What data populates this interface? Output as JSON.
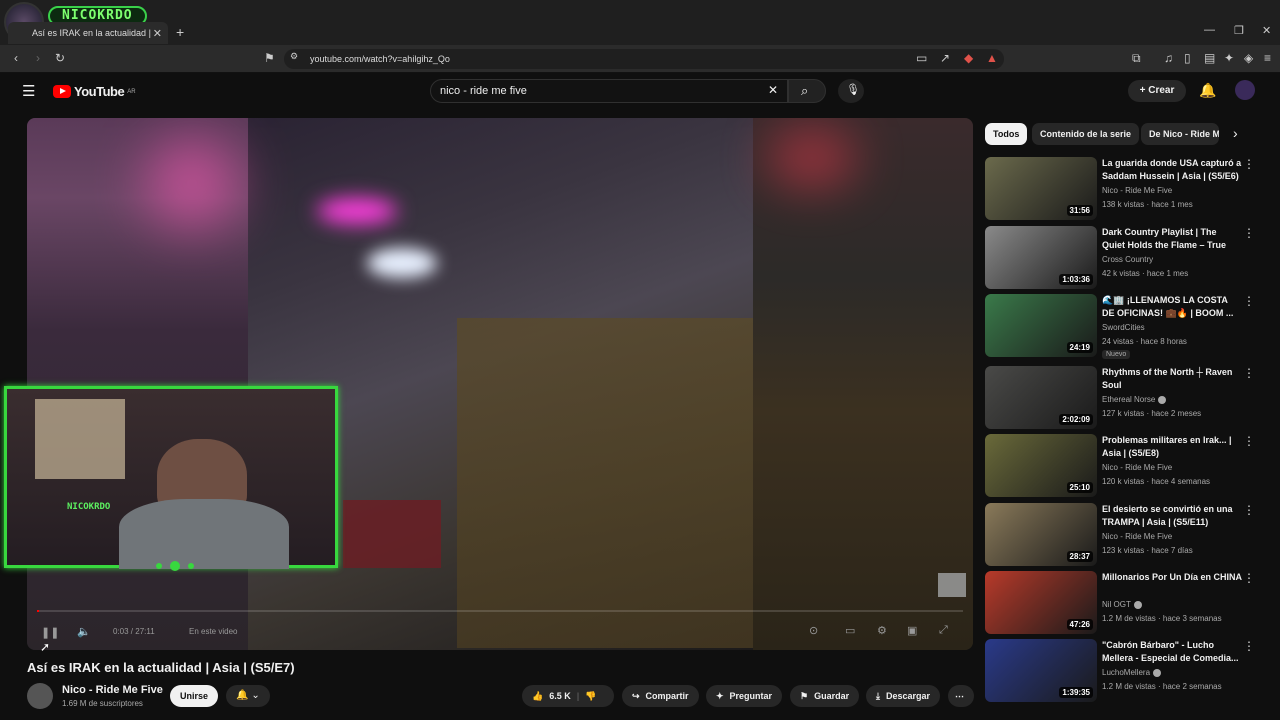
{
  "browser": {
    "tab_title": "Así es IRAK en la actualidad |",
    "url": "youtube.com/watch?v=ahilgihz_Qo",
    "overlay_name": "NICOKRDO"
  },
  "youtube": {
    "logo_text": "YouTube",
    "logo_region": "AR",
    "search_value": "nico - ride me five",
    "create_label": "Crear"
  },
  "player": {
    "time": "0:03 / 27:11",
    "watching": "En este video",
    "webcam_name": "NICOKRDO",
    "progress": 0.002
  },
  "video": {
    "title": "Así es IRAK en la actualidad | Asia | (S5/E7)",
    "channel": "Nico - Ride Me Five",
    "subscribers": "1.69 M de suscriptores",
    "join_label": "Unirse",
    "likes": "6.5 K",
    "share": "Compartir",
    "ask": "Preguntar",
    "save": "Guardar",
    "download": "Descargar"
  },
  "chips": [
    "Todos",
    "Contenido de la serie",
    "De Nico - Ride M"
  ],
  "recommendations": [
    {
      "title": "La guarida donde USA capturó a Saddam Hussein | Asia | (S5/E6)",
      "channel": "Nico - Ride Me Five",
      "meta": "138 k vistas · hace 1 mes",
      "duration": "31:56",
      "color": "#6b6a4c"
    },
    {
      "title": "Dark Country Playlist | The Quiet Holds the Flame – True Grit in ...",
      "channel": "Cross Country",
      "meta": "42 k vistas · hace 1 mes",
      "duration": "1:03:36",
      "color": "#8a8a8a"
    },
    {
      "title": "🌊🏢 ¡LLENAMOS LA COSTA DE OFICINAS! 💼🔥 | BOOM ...",
      "channel": "SwordCities",
      "meta": "24 vistas · hace 8 horas",
      "duration": "24:19",
      "color": "#3a7a4a",
      "badge": "Nuevo"
    },
    {
      "title": "Rhythms of the North ┼ Raven Soul",
      "channel": "Ethereal Norse",
      "meta": "127 k vistas · hace 2 meses",
      "duration": "2:02:09",
      "color": "#4a4a48",
      "verified": true
    },
    {
      "title": "Problemas militares en Irak... | Asia | (S5/E8)",
      "channel": "Nico - Ride Me Five",
      "meta": "120 k vistas · hace 4 semanas",
      "duration": "25:10",
      "color": "#6a6a3a"
    },
    {
      "title": "El desierto se convirtió en una TRAMPA | Asia | (S5/E11)",
      "channel": "Nico - Ride Me Five",
      "meta": "123 k vistas · hace 7 días",
      "duration": "28:37",
      "color": "#8a7a5a"
    },
    {
      "title": "Millonarios Por Un Día en CHINA",
      "channel": "Nil OGT",
      "meta": "1.2 M de vistas · hace 3 semanas",
      "duration": "47:26",
      "color": "#b83a2a",
      "verified": true
    },
    {
      "title": "\"Cabrón Bárbaro\" - Lucho Mellera - Especial de Comedia...",
      "channel": "LuchoMellera",
      "meta": "1.2 M de vistas · hace 2 semanas",
      "duration": "1:39:35",
      "color": "#2a3a8a",
      "verified": true
    }
  ]
}
